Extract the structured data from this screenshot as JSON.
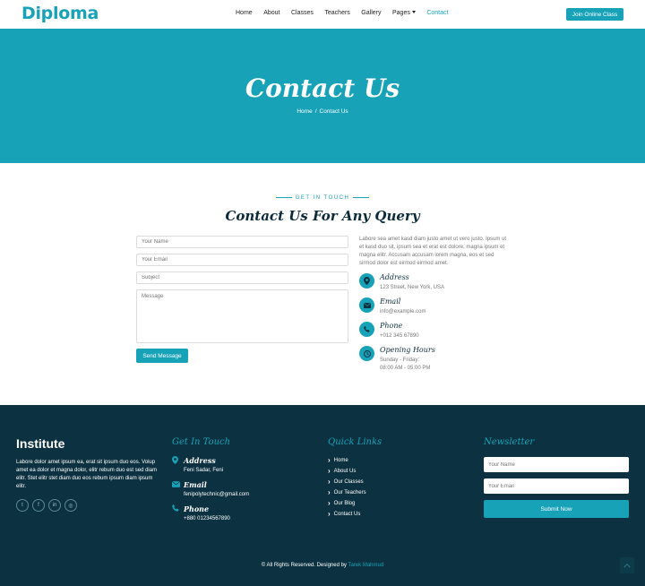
{
  "navbar": {
    "brand": "Diploma",
    "links": [
      "Home",
      "About",
      "Classes",
      "Teachers",
      "Gallery",
      "Pages",
      "Contact"
    ],
    "cta": "Join Online Class"
  },
  "hero": {
    "title": "Contact Us",
    "breadcrumb": [
      "Home",
      "Contact Us"
    ],
    "separator": "/"
  },
  "contact": {
    "eyebrow": "GET IN TOUCH",
    "title": "Contact Us For Any Query",
    "form": {
      "name_placeholder": "Your Name",
      "email_placeholder": "Your Email",
      "subject_placeholder": "Subject",
      "message_placeholder": "Message",
      "submit_label": "Send Message"
    },
    "description": "Labore sea amet kasd diam justo amet ut vero justo. Ipsum ut et kasd duo sit, ipsum sea et erat est dolore, magna ipsum et magna elitr. Accusam accusam lorem magna, eos et sed sirmod dolor est eirmod eirmod amet.",
    "info": {
      "address_label": "Address",
      "address_value": "123 Street, New York, USA",
      "email_label": "Email",
      "email_value": "info@example.com",
      "phone_label": "Phone",
      "phone_value": "+012 345 67890",
      "hours_label": "Opening Hours",
      "hours_line1": "Sunday - Friday:",
      "hours_line2": "08:00 AM - 05:00 PM"
    }
  },
  "footer": {
    "brand": "Institute",
    "about": "Labore dolor amet ipsum ea, erat sit ipsum duo eos. Volup amet ea dolor et magna dolor, elitr rebum duo est sed diam elitr. Stet elitr stet diam duo eos rebum ipsum diam ipsum elitr.",
    "social": {
      "twitter": "t",
      "facebook": "f",
      "linkedin": "in",
      "instagram": "◎"
    },
    "touch": {
      "heading": "Get In Touch",
      "address_label": "Address",
      "address_value": "Feni Sadar, Feni",
      "email_label": "Email",
      "email_value": "fenipolytechnic@gmail.com",
      "phone_label": "Phone",
      "phone_value": "+880 01234567890"
    },
    "quick_links": {
      "heading": "Quick Links",
      "items": [
        "Home",
        "About Us",
        "Our Classes",
        "Our Teachers",
        "Our Blog",
        "Contact Us"
      ]
    },
    "newsletter": {
      "heading": "Newsletter",
      "name_placeholder": "Your Name",
      "email_placeholder": "Your Email",
      "submit_label": "Submit Now"
    },
    "copyright_text": "© All Rights Reserved. Designed by",
    "author": "Tarek Mahmud"
  },
  "icons": {
    "map_marker": "map-marker-icon",
    "envelope": "envelope-icon",
    "phone": "phone-icon",
    "clock": "clock-icon",
    "chevron_up": "chevron-up-icon"
  },
  "colors": {
    "accent": "#17a2b8",
    "footer_bg": "#0c3140",
    "heading_dark": "#0c2b3a"
  }
}
